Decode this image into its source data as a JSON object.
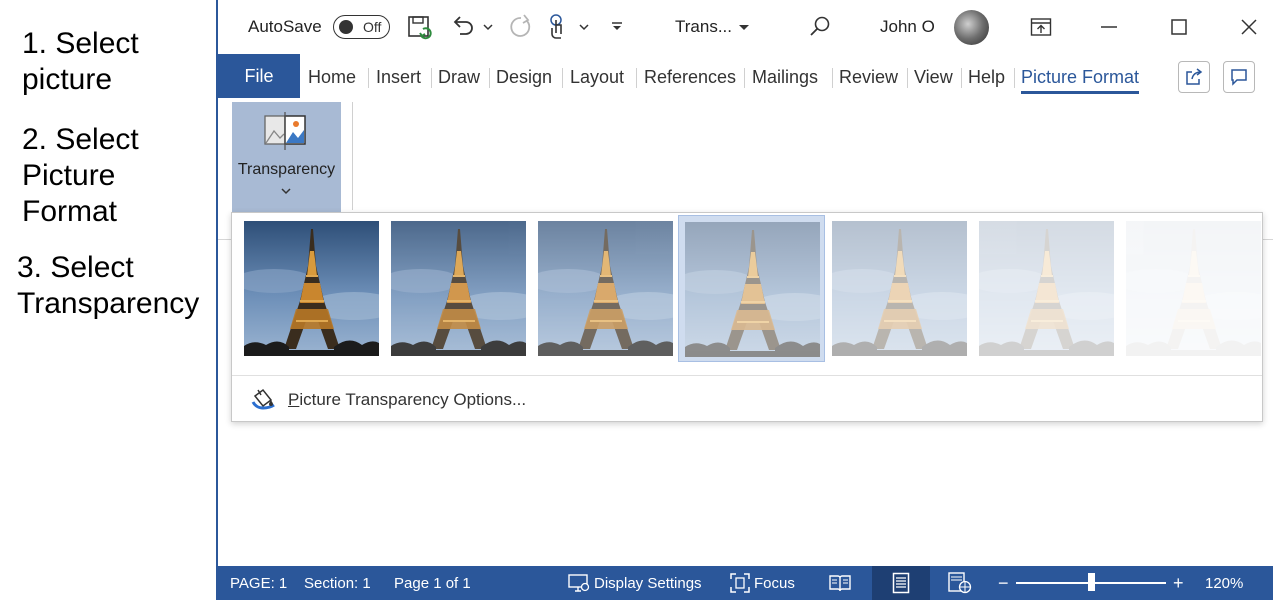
{
  "instructions": {
    "step1": "1. Select\npicture",
    "step2": "2. Select\nPicture\nFormat",
    "step3": "3. Select\nTransparency"
  },
  "titlebar": {
    "autosave_label": "AutoSave",
    "autosave_state": "Off",
    "doc_title": "Trans...",
    "user_name": "John O",
    "icons": [
      "save-icon",
      "undo-icon",
      "redo-icon",
      "touch-mode-icon",
      "customize-qat-icon",
      "search-icon",
      "ribbon-display-icon",
      "minimize-icon",
      "maximize-icon",
      "close-icon"
    ]
  },
  "tabs": {
    "file": "File",
    "items": [
      "Home",
      "Insert",
      "Draw",
      "Design",
      "Layout",
      "References",
      "Mailings",
      "Review",
      "View",
      "Help",
      "Picture Format"
    ],
    "active": "Picture Format"
  },
  "ribbon": {
    "transparency_label": "Transparency"
  },
  "gallery": {
    "presets_opacity": [
      1.0,
      0.85,
      0.7,
      0.5,
      0.35,
      0.2,
      0.05
    ],
    "selected_index": 3,
    "options_prefix": "P",
    "options_rest": "icture Transparency Options..."
  },
  "statusbar": {
    "page": "PAGE: 1",
    "section": "Section: 1",
    "page_of": "Page 1 of 1",
    "display_settings": "Display Settings",
    "focus": "Focus",
    "zoom_out": "−",
    "zoom_in": "+",
    "zoom": "120%",
    "zoom_level_fraction": 0.5
  },
  "colors": {
    "accent": "#2b579a",
    "selected_button": "#a8bad4",
    "selected_thumb": "#cfdcef"
  }
}
